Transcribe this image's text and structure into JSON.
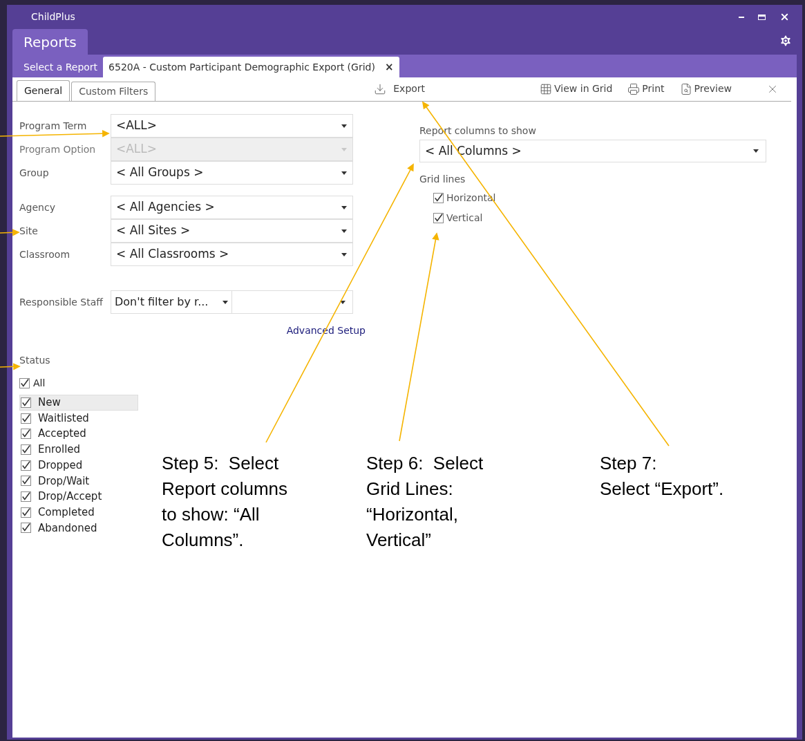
{
  "window": {
    "title": "ChildPlus"
  },
  "app_tab": {
    "label": "Reports"
  },
  "doc_tabs": [
    {
      "label": "Select a Report",
      "selected": false
    },
    {
      "label": "6520A - Custom Participant Demographic Export (Grid)",
      "selected": true,
      "close": "×"
    }
  ],
  "sub_tabs": [
    {
      "label": "General",
      "selected": true
    },
    {
      "label": "Custom Filters",
      "selected": false
    }
  ],
  "toolbar": [
    {
      "kind": "export",
      "label": "Export"
    },
    {
      "kind": "grid",
      "label": "View in Grid"
    },
    {
      "kind": "print",
      "label": "Print"
    },
    {
      "kind": "preview",
      "label": "Preview"
    },
    {
      "kind": "close"
    }
  ],
  "filter_groups": [
    [
      {
        "kind": "select",
        "label": "Program Term",
        "value": "<ALL>",
        "disabled": false
      },
      {
        "kind": "select",
        "label": "Program Option",
        "value": "<ALL>",
        "disabled": true
      },
      {
        "kind": "select",
        "label": "Group",
        "value": "< All Groups >",
        "disabled": false
      }
    ],
    [
      {
        "kind": "select",
        "label": "Agency",
        "value": "< All Agencies >",
        "disabled": false
      },
      {
        "kind": "select",
        "label": "Site",
        "value": "< All Sites >",
        "disabled": false
      },
      {
        "kind": "select",
        "label": "Classroom",
        "value": "< All Classrooms >",
        "disabled": false
      }
    ],
    [
      {
        "kind": "split",
        "label": "Responsible Staff",
        "value": "Don't filter by r..."
      }
    ]
  ],
  "advanced_link": "Advanced Setup",
  "status": {
    "title": "Status",
    "all": {
      "label": "All",
      "checked": true
    },
    "items": [
      {
        "label": "New",
        "checked": true,
        "selected": true
      },
      {
        "label": "Waitlisted",
        "checked": true,
        "selected": false
      },
      {
        "label": "Accepted",
        "checked": true,
        "selected": false
      },
      {
        "label": "Enrolled",
        "checked": true,
        "selected": false
      },
      {
        "label": "Dropped",
        "checked": true,
        "selected": false
      },
      {
        "label": "Drop/Wait",
        "checked": true,
        "selected": false
      },
      {
        "label": "Drop/Accept",
        "checked": true,
        "selected": false
      },
      {
        "label": "Completed",
        "checked": true,
        "selected": false
      },
      {
        "label": "Abandoned",
        "checked": true,
        "selected": false
      }
    ]
  },
  "report_columns": {
    "label": "Report columns to show",
    "value": "< All Columns >"
  },
  "grid_lines": {
    "title": "Grid lines",
    "items": [
      {
        "label": "Horizontal",
        "checked": true
      },
      {
        "label": "Vertical",
        "checked": true
      }
    ]
  },
  "annotations": [
    {
      "text": "Step 5:  Select\nReport columns\nto show: “All\nColumns”."
    },
    {
      "text": "Step 6:  Select\nGrid Lines:\n“Horizontal,\nVertical”"
    },
    {
      "text": "Step 7:\nSelect “Export”."
    }
  ]
}
